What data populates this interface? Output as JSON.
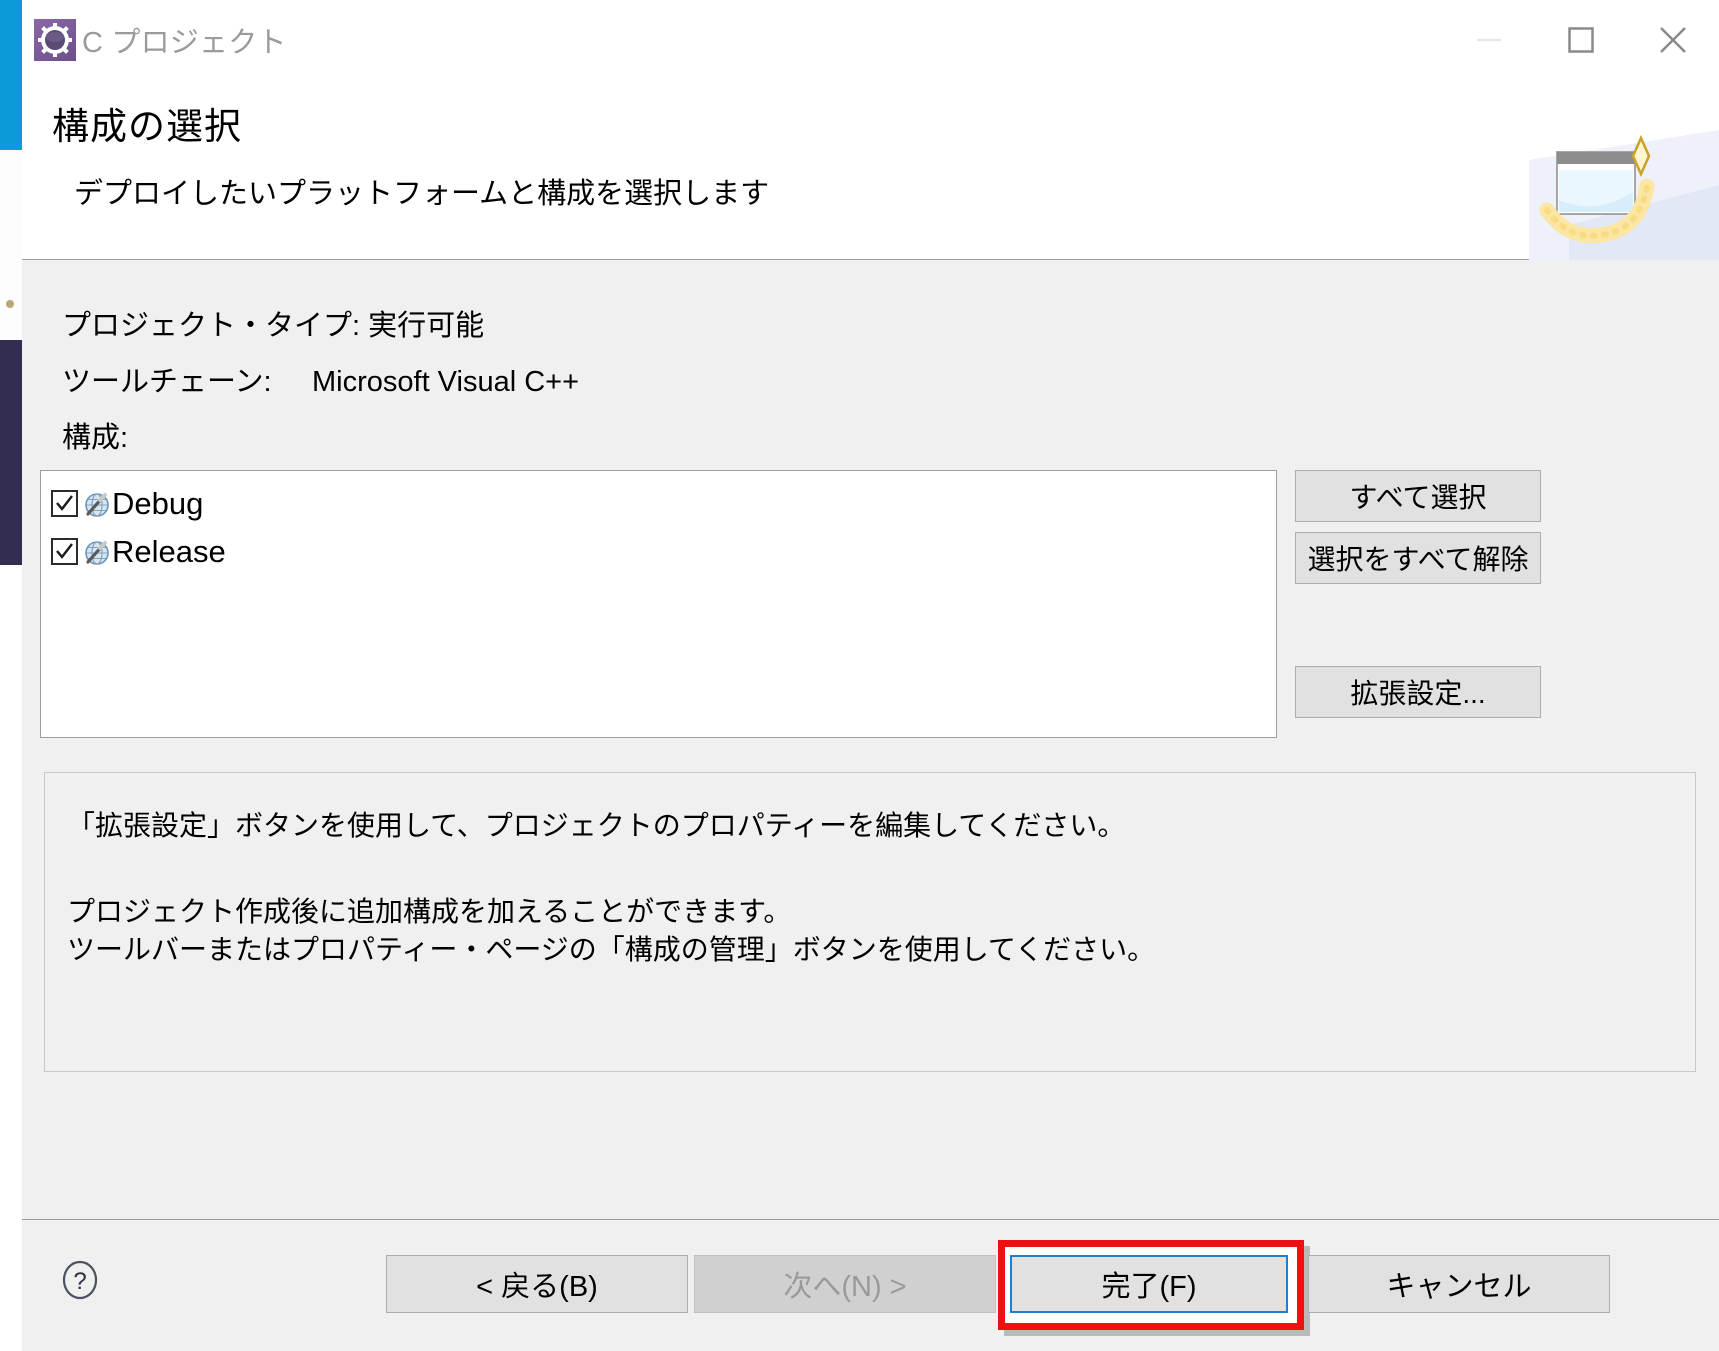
{
  "window": {
    "title": "C プロジェクト",
    "app_icon": "gear-icon",
    "controls": {
      "minimize": "minimize-icon",
      "maximize": "maximize-icon",
      "close": "close-icon"
    }
  },
  "header": {
    "title": "構成の選択",
    "subtitle": "デプロイしたいプラットフォームと構成を選択します",
    "banner_icon": "wizard-window-sparkle-icon"
  },
  "info": {
    "project_type_label": "プロジェクト・タイプ:",
    "project_type_value": "実行可能",
    "toolchain_label": "ツールチェーン:",
    "toolchain_value": "Microsoft Visual C++",
    "configurations_label": "構成:"
  },
  "configurations": [
    {
      "label": "Debug",
      "checked": true,
      "icon": "configuration-globe-icon"
    },
    {
      "label": "Release",
      "checked": true,
      "icon": "configuration-globe-icon"
    }
  ],
  "side_buttons": {
    "select_all": "すべて選択",
    "deselect_all": "選択をすべて解除",
    "advanced_settings": "拡張設定..."
  },
  "description": {
    "line1": "「拡張設定」ボタンを使用して、プロジェクトのプロパティーを編集してください。",
    "line2": "プロジェクト作成後に追加構成を加えることができます。",
    "line3": "ツールバーまたはプロパティー・ページの「構成の管理」ボタンを使用してください。"
  },
  "footer": {
    "help": "help-icon",
    "back": "< 戻る(B)",
    "next": "次へ(N) >",
    "finish": "完了(F)",
    "cancel": "キャンセル"
  },
  "colors": {
    "accent_blue": "#0b9bd8",
    "focus_blue": "#1d7fd0",
    "highlight_red": "#ee1111",
    "dialog_bg": "#f0f0f0",
    "button_bg": "#e1e1e1",
    "disabled_text": "#9a9a9a"
  }
}
